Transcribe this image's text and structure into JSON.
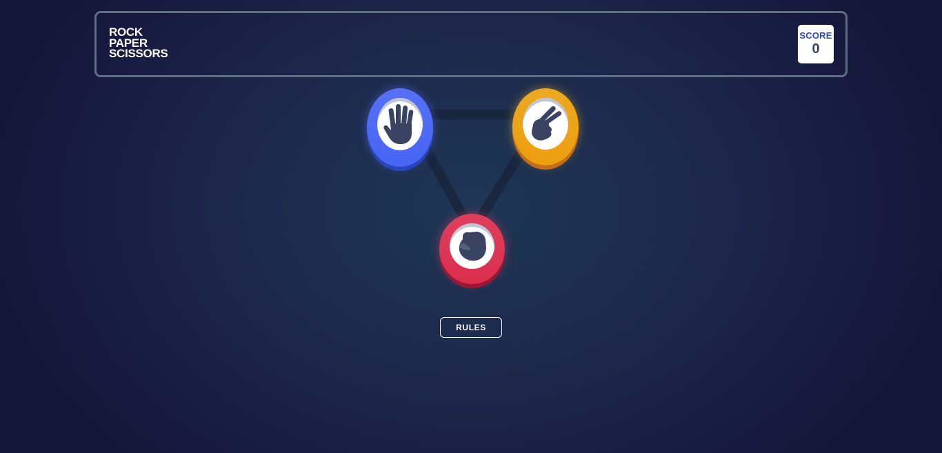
{
  "header": {
    "title_lines": [
      "ROCK",
      "PAPER",
      "SCISSORS"
    ],
    "score": {
      "label": "SCORE",
      "value": "0"
    }
  },
  "choices": [
    {
      "id": "paper",
      "icon": "paper-hand-icon",
      "color": "#5671f5"
    },
    {
      "id": "scissors",
      "icon": "scissors-hand-icon",
      "color": "#eca922"
    },
    {
      "id": "rock",
      "icon": "rock-fist-icon",
      "color": "#dd405d"
    }
  ],
  "rules_button": {
    "label": "RULES"
  }
}
